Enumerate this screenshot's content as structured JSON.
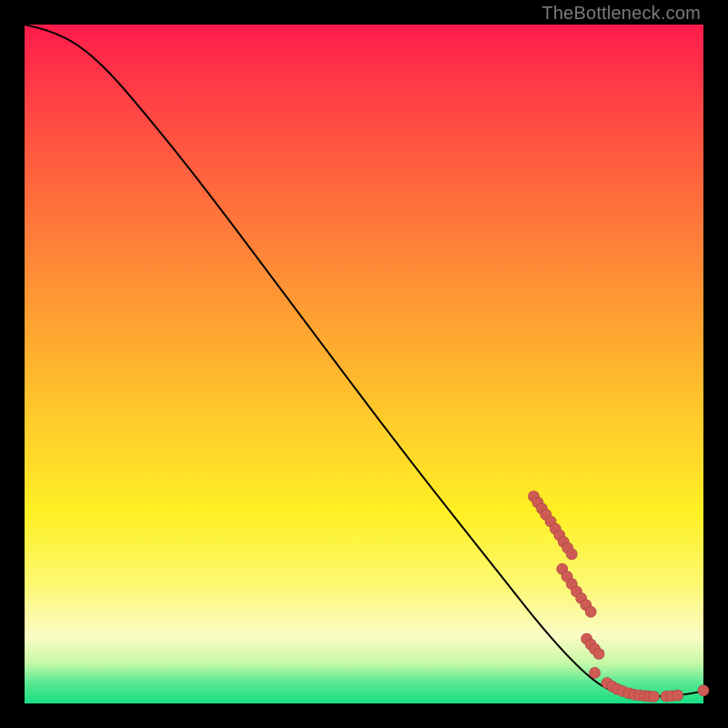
{
  "watermark": "TheBottleneck.com",
  "colors": {
    "point_fill": "#cf5b55",
    "point_stroke": "#a8423d",
    "line": "#000000",
    "frame_background": "#000000"
  },
  "chart_data": {
    "type": "line",
    "title": "",
    "xlabel": "",
    "ylabel": "",
    "xlim": [
      0,
      100
    ],
    "ylim": [
      0,
      100
    ],
    "grid": false,
    "legend": false,
    "curve": [
      {
        "x": 0,
        "y": 100
      },
      {
        "x": 4,
        "y": 99
      },
      {
        "x": 8,
        "y": 97
      },
      {
        "x": 12,
        "y": 93.5
      },
      {
        "x": 16,
        "y": 89
      },
      {
        "x": 25,
        "y": 78
      },
      {
        "x": 40,
        "y": 58
      },
      {
        "x": 55,
        "y": 38
      },
      {
        "x": 70,
        "y": 19
      },
      {
        "x": 78,
        "y": 9
      },
      {
        "x": 84,
        "y": 3
      },
      {
        "x": 88,
        "y": 1.2
      },
      {
        "x": 92,
        "y": 1
      },
      {
        "x": 96,
        "y": 1.1
      },
      {
        "x": 100,
        "y": 1.8
      }
    ],
    "points": [
      {
        "x": 75.0,
        "y": 30.5
      },
      {
        "x": 75.6,
        "y": 29.6
      },
      {
        "x": 76.2,
        "y": 28.7
      },
      {
        "x": 76.8,
        "y": 27.8
      },
      {
        "x": 77.5,
        "y": 26.8
      },
      {
        "x": 78.2,
        "y": 25.7
      },
      {
        "x": 78.8,
        "y": 24.8
      },
      {
        "x": 79.4,
        "y": 23.8
      },
      {
        "x": 80.0,
        "y": 22.9
      },
      {
        "x": 80.6,
        "y": 22.0
      },
      {
        "x": 79.2,
        "y": 19.8
      },
      {
        "x": 79.9,
        "y": 18.7
      },
      {
        "x": 80.6,
        "y": 17.6
      },
      {
        "x": 81.3,
        "y": 16.5
      },
      {
        "x": 82.0,
        "y": 15.5
      },
      {
        "x": 82.7,
        "y": 14.5
      },
      {
        "x": 83.4,
        "y": 13.5
      },
      {
        "x": 82.8,
        "y": 9.5
      },
      {
        "x": 83.4,
        "y": 8.7
      },
      {
        "x": 84.0,
        "y": 8.0
      },
      {
        "x": 84.6,
        "y": 7.3
      },
      {
        "x": 84.0,
        "y": 4.5
      },
      {
        "x": 85.8,
        "y": 3.0
      },
      {
        "x": 86.6,
        "y": 2.5
      },
      {
        "x": 87.3,
        "y": 2.1
      },
      {
        "x": 88.1,
        "y": 1.8
      },
      {
        "x": 89.0,
        "y": 1.5
      },
      {
        "x": 89.8,
        "y": 1.3
      },
      {
        "x": 90.6,
        "y": 1.2
      },
      {
        "x": 91.4,
        "y": 1.1
      },
      {
        "x": 92.0,
        "y": 1.05
      },
      {
        "x": 92.7,
        "y": 1.0
      },
      {
        "x": 94.5,
        "y": 1.05
      },
      {
        "x": 95.3,
        "y": 1.1
      },
      {
        "x": 96.2,
        "y": 1.2
      },
      {
        "x": 100.0,
        "y": 1.9
      }
    ]
  }
}
